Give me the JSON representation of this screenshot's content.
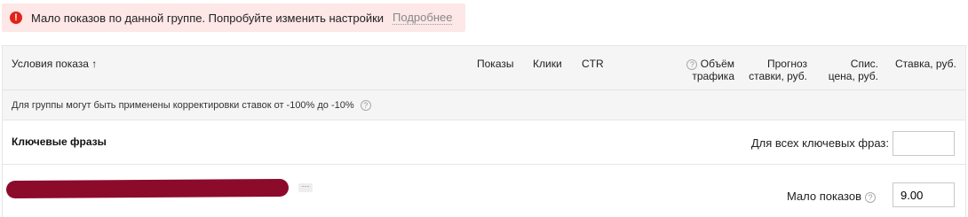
{
  "alert": {
    "icon": "exclamation-icon",
    "text": "Мало показов по данной группе. Попробуйте изменить настройки",
    "link": "Подробнее",
    "color": "#e2231a"
  },
  "table": {
    "headers": {
      "conditions": "Условия показа ↑",
      "shows": "Показы",
      "clicks": "Клики",
      "ctr": "CTR",
      "traffic_line1": "Объём",
      "traffic_line2": "трафика",
      "forecast_line1": "Прогноз",
      "forecast_line2": "ставки, руб.",
      "writeoff_line1": "Спис.",
      "writeoff_line2": "цена, руб.",
      "bid": "Ставка, руб."
    },
    "note": "Для группы могут быть применены корректировки ставок от -100% до -10%",
    "section_title": "Ключевые фразы",
    "all_phrases_label": "Для всех ключевых фраз:",
    "all_phrases_value": "",
    "keyword": {
      "status": "Мало показов",
      "bid": "9.00",
      "more_label": "···"
    }
  }
}
